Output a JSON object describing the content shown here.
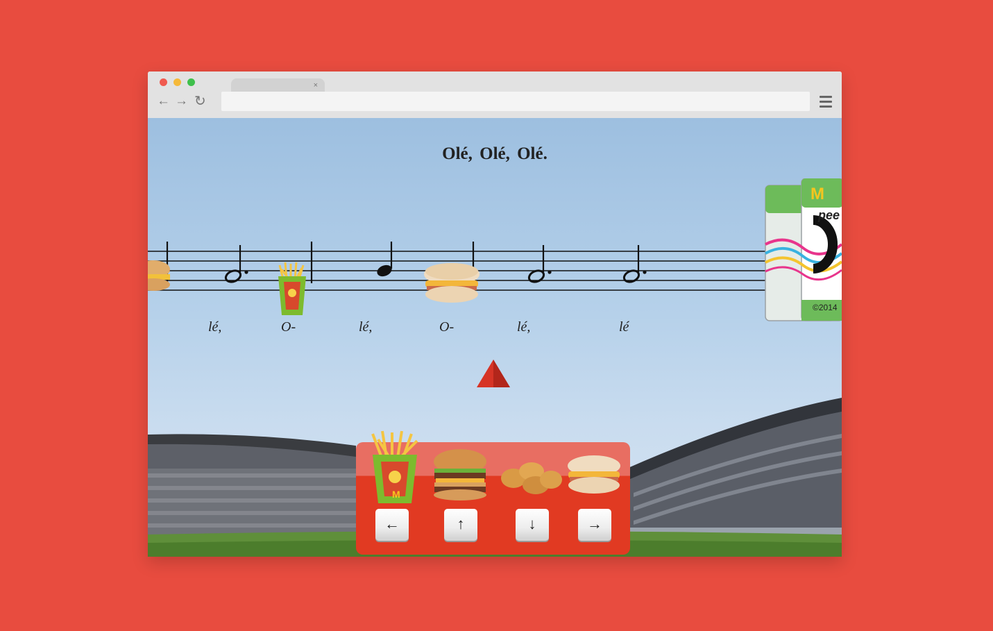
{
  "browser": {
    "tab_close": "×",
    "nav_back": "←",
    "nav_forward": "→",
    "nav_reload": "↻",
    "traffic_colors": [
      "#f05a4f",
      "#f5b93a",
      "#3fc04c"
    ],
    "menu_icon": "hamburger-menu-icon"
  },
  "game": {
    "title": "Olé,  Olé,  Olé.",
    "lyrics": [
      "lé,",
      "O-",
      "lé,",
      "O-",
      "lé,",
      "lé"
    ],
    "food_items": [
      "fries-icon",
      "big-mac-icon",
      "nuggets-icon",
      "mcmuffin-icon"
    ],
    "arrow_keys": [
      "←",
      "↑",
      "↓",
      "→"
    ],
    "card_text": {
      "brand": "M",
      "word": "pee",
      "copyright": "©2014"
    },
    "colors": {
      "background": "#e84c3f",
      "panel_top": "#e86e62",
      "panel_bottom": "#e13a22",
      "pointer": "#d63426"
    }
  }
}
